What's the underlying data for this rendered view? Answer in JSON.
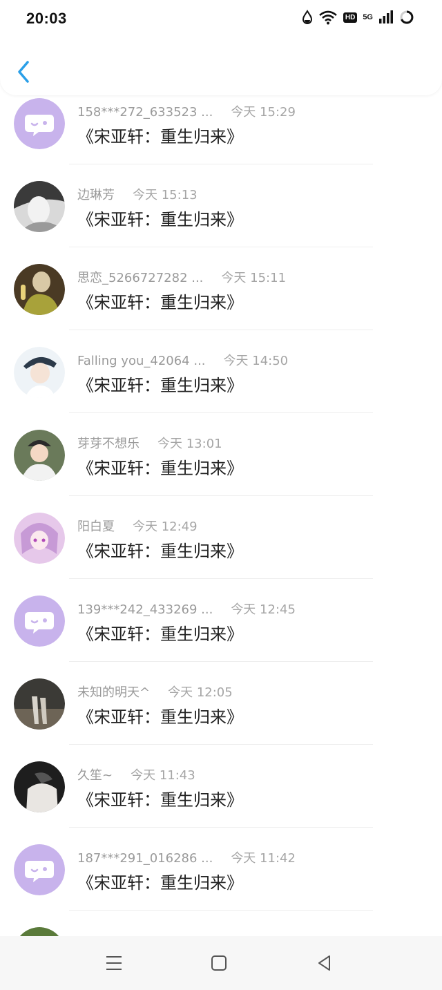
{
  "status_bar": {
    "time": "20:03",
    "hd_badge": "HD",
    "network_label": "5G"
  },
  "header": {
    "back_icon": "chevron-left-icon",
    "accent_color": "#2a9fe8"
  },
  "items": [
    {
      "name": "158***272_633523 ...",
      "time": "今天 15:29",
      "title": "《宋亚轩：重生归来》",
      "avatar": "chat-bubble"
    },
    {
      "name": "边琳芳",
      "time": "今天 15:13",
      "title": "《宋亚轩：重生归来》",
      "avatar": "photo-grey"
    },
    {
      "name": "思恋_5266727282 ...",
      "time": "今天 15:11",
      "title": "《宋亚轩：重生归来》",
      "avatar": "photo-olive"
    },
    {
      "name": "Falling you_42064 ...",
      "time": "今天 14:50",
      "title": "《宋亚轩：重生归来》",
      "avatar": "photo-white"
    },
    {
      "name": "芽芽不想乐",
      "time": "今天 13:01",
      "title": "《宋亚轩：重生归来》",
      "avatar": "photo-kid"
    },
    {
      "name": "阳白夏",
      "time": "今天 12:49",
      "title": "《宋亚轩：重生归来》",
      "avatar": "photo-anime"
    },
    {
      "name": "139***242_433269 ...",
      "time": "今天 12:45",
      "title": "《宋亚轩：重生归来》",
      "avatar": "chat-bubble"
    },
    {
      "name": "未知的明天^",
      "time": "今天 12:05",
      "title": "《宋亚轩：重生归来》",
      "avatar": "photo-night"
    },
    {
      "name": "久笙~",
      "time": "今天 11:43",
      "title": "《宋亚轩：重生归来》",
      "avatar": "photo-dark"
    },
    {
      "name": "187***291_016286 ...",
      "time": "今天 11:42",
      "title": "《宋亚轩：重生归来》",
      "avatar": "chat-bubble"
    },
    {
      "name": "",
      "time": "",
      "title": "",
      "avatar": "photo-dog"
    }
  ],
  "nav": {
    "menu_icon": "menu-icon",
    "home_icon": "home-square-icon",
    "back_icon": "triangle-back-icon"
  }
}
